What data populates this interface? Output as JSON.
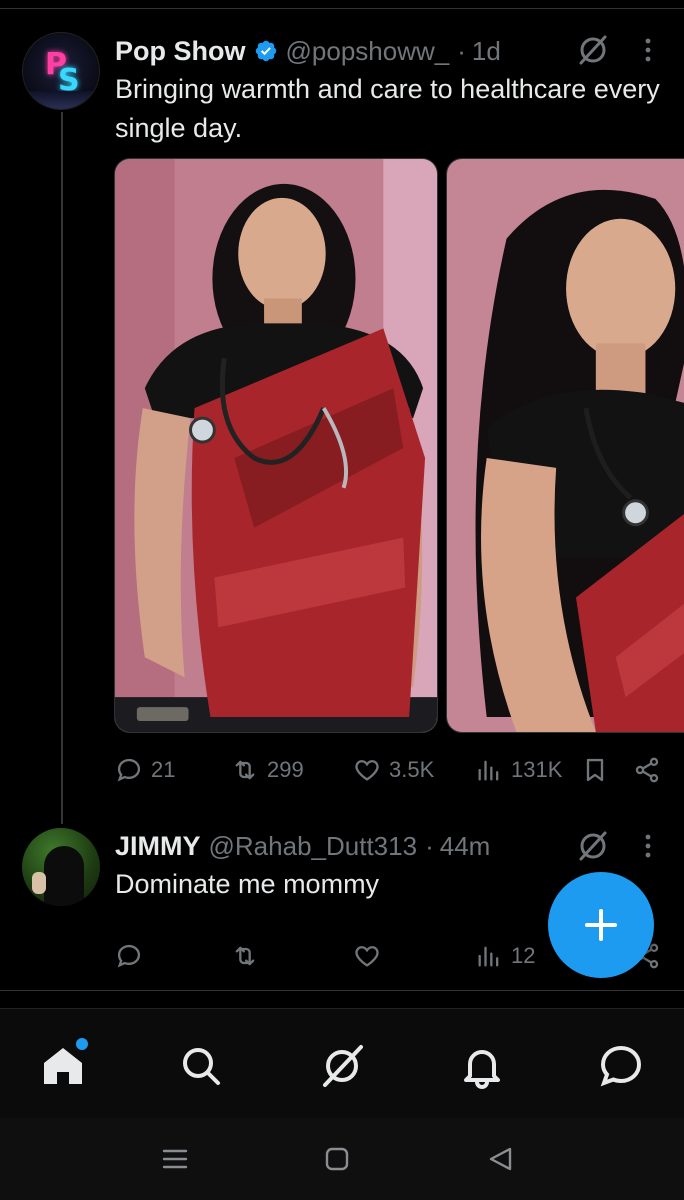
{
  "tweet1": {
    "name": "Pop Show",
    "handle": "@popshoww_",
    "separator": "·",
    "time": "1d",
    "text": "Bringing warmth and care to healthcare every single day.",
    "replies": "21",
    "reposts": "299",
    "likes": "3.5K",
    "views": "131K"
  },
  "tweet2": {
    "name": "JIMMY",
    "handle": "@Rahab_Dutt313",
    "separator": "·",
    "time": "44m",
    "text": "Dominate me mommy",
    "replies": "",
    "reposts": "",
    "likes": "",
    "views": "12"
  },
  "colors": {
    "accent": "#1d9bf0",
    "secondary_text": "#71767b",
    "primary_text": "#e7e9ea"
  },
  "icons": {
    "reply": "reply-icon",
    "repost": "repost-icon",
    "like": "heart-icon",
    "views": "views-icon",
    "bookmark": "bookmark-icon",
    "share": "share-icon",
    "grok": "grok-icon",
    "more": "more-vertical-icon",
    "compose": "plus-icon",
    "home": "home-icon",
    "search": "search-icon",
    "notifications": "bell-icon",
    "messages": "message-icon"
  }
}
